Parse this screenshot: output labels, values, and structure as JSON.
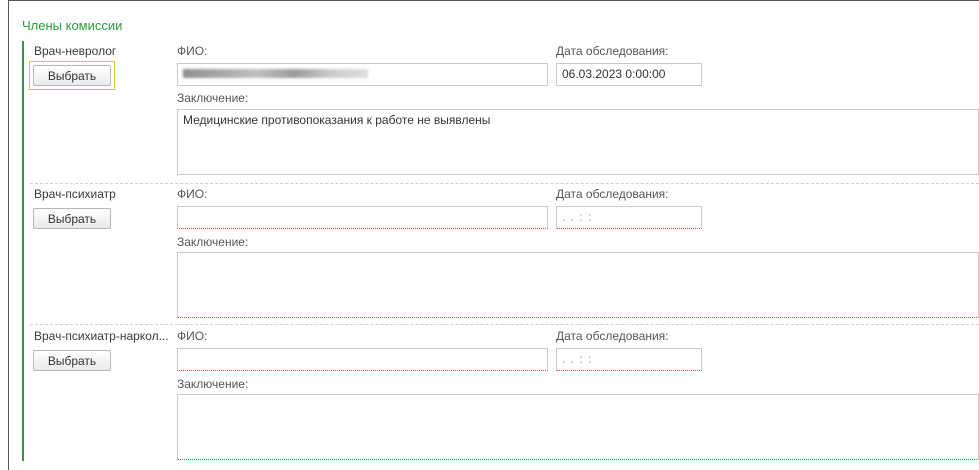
{
  "group_title": "Члены комиссии",
  "labels": {
    "fio": "ФИО:",
    "date": "Дата обследования:",
    "conclusion": "Заключение:",
    "select_button": "Выбрать"
  },
  "members": [
    {
      "role": "Врач-невролог",
      "fio_value": "",
      "fio_redacted": true,
      "date_value": "06.03.2023  0:00:00",
      "conclusion_value": "Медицинские противопоказания к работе не выявлены"
    },
    {
      "role": "Врач-психиатр",
      "fio_value": "",
      "date_value": "  .  .        :  :  ",
      "conclusion_value": ""
    },
    {
      "role": "Врач-психиатр-наркол...",
      "fio_value": "",
      "date_value": "  .  .        :  :  ",
      "conclusion_value": ""
    }
  ],
  "colors": {
    "group_accent": "#2e9a3c",
    "required_underline": "#e04040",
    "focus_border": "#e8c23c"
  }
}
